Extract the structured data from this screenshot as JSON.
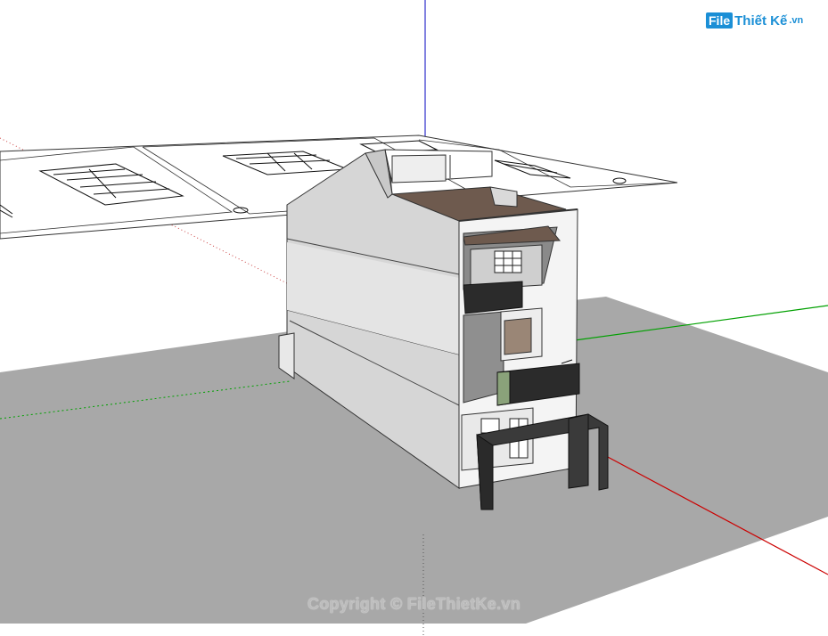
{
  "watermark": {
    "logo_box": "File",
    "logo_rest": "Thiết Kế",
    "logo_tld": ".vn",
    "copyright": "Copyright © FileThietKe.vn"
  },
  "colors": {
    "ground": "#a9a9a9",
    "wall_light": "#f2f2f2",
    "wall_side": "#cfcfcf",
    "roof": "#6e5a4e",
    "dark_panel": "#2b2b2b",
    "axis_red": "#cc0000",
    "axis_green": "#00a000",
    "axis_blue": "#2020cc"
  }
}
